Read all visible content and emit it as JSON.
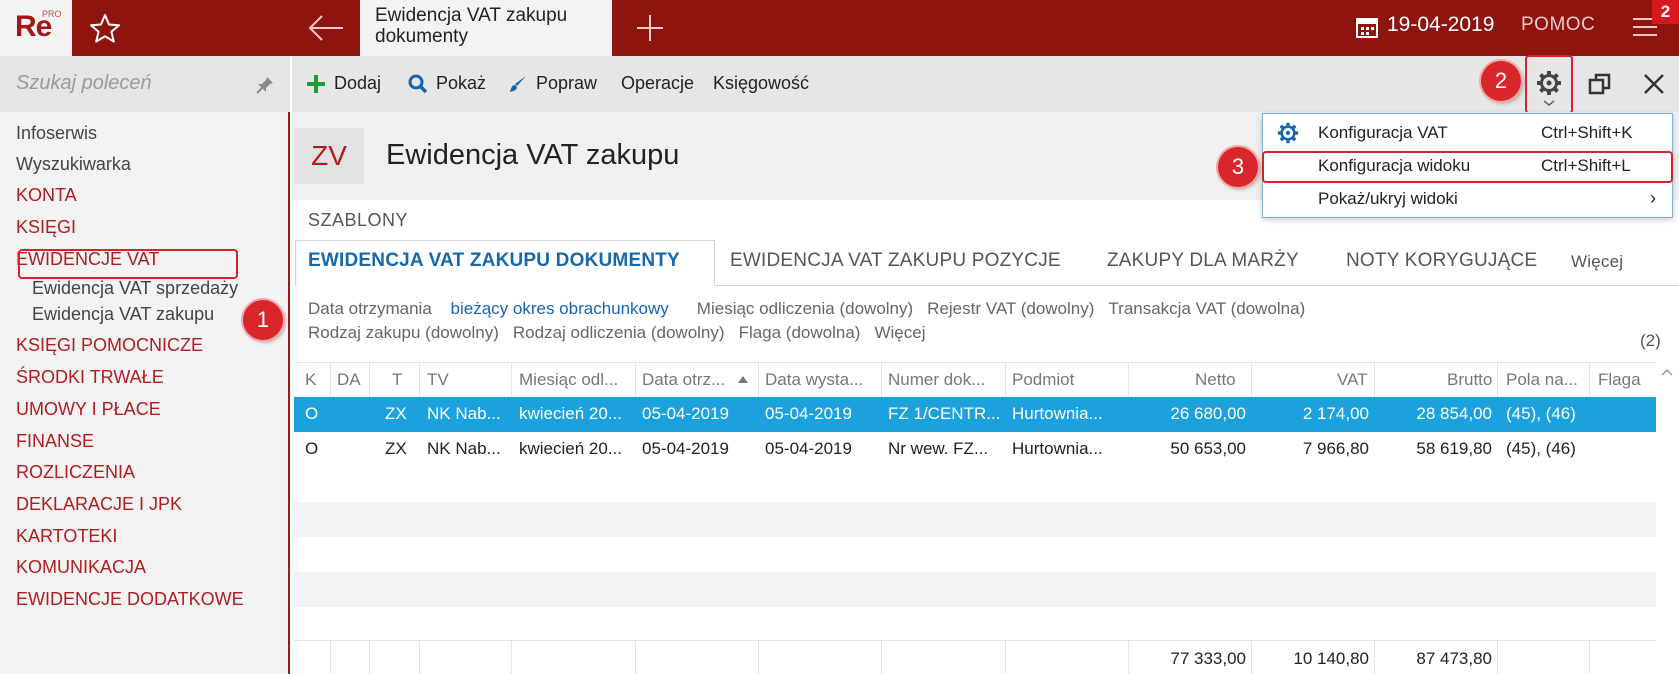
{
  "app": {
    "logo_text": "Re",
    "logo_sup": "PRO",
    "active_tab": "Ewidencja VAT zakupu dokumenty",
    "date": "19-04-2019",
    "help": "POMOC",
    "notification_count": "2"
  },
  "sidebar": {
    "search_placeholder": "Szukaj poleceń",
    "items": [
      {
        "label": "Infoserwis"
      },
      {
        "label": "Wyszukiwarka"
      },
      {
        "label": "KONTA"
      },
      {
        "label": "KSIĘGI"
      },
      {
        "label": "EWIDENCJE VAT"
      },
      {
        "label": "Ewidencja VAT sprzedaży"
      },
      {
        "label": "Ewidencja VAT zakupu"
      },
      {
        "label": "KSIĘGI POMOCNICZE"
      },
      {
        "label": "ŚRODKI TRWAŁE"
      },
      {
        "label": "UMOWY I PŁACE"
      },
      {
        "label": "FINANSE"
      },
      {
        "label": "ROZLICZENIA"
      },
      {
        "label": "DEKLARACJE I JPK"
      },
      {
        "label": "KARTOTEKI"
      },
      {
        "label": "KOMUNIKACJA"
      },
      {
        "label": "EWIDENCJE DODATKOWE"
      }
    ]
  },
  "callouts": {
    "one": "1",
    "two": "2",
    "three": "3"
  },
  "toolbar": {
    "add": "Dodaj",
    "show": "Pokaż",
    "edit": "Popraw",
    "operations": "Operacje",
    "accounting": "Księgowość"
  },
  "header": {
    "badge": "ZV",
    "title": "Ewidencja VAT zakupu"
  },
  "templates": {
    "label": "SZABLONY",
    "tabs": [
      {
        "label": "EWIDENCJA VAT ZAKUPU DOKUMENTY"
      },
      {
        "label": "EWIDENCJA VAT ZAKUPU POZYCJE"
      },
      {
        "label": "ZAKUPY DLA MARŻY"
      },
      {
        "label": "NOTY KORYGUJĄCE"
      },
      {
        "label": "Więcej"
      }
    ]
  },
  "filters": {
    "row1": [
      {
        "label": "Data otrzymania",
        "value": "bieżący okres obrachunkowy"
      },
      {
        "label": "Miesiąc odliczenia (dowolny)"
      },
      {
        "label": "Rejestr VAT (dowolny)"
      },
      {
        "label": "Transakcja VAT (dowolna)"
      }
    ],
    "row2": [
      {
        "label": "Rodzaj zakupu (dowolny)"
      },
      {
        "label": "Rodzaj odliczenia (dowolny)"
      },
      {
        "label": "Flaga (dowolna)"
      },
      {
        "label": "Więcej"
      }
    ],
    "count": "(2)"
  },
  "grid": {
    "columns": [
      "K",
      "DA",
      "T",
      "TV",
      "Miesiąc odl...",
      "Data otrz...",
      "Data wysta...",
      "Numer dok...",
      "Podmiot",
      "Netto",
      "VAT",
      "Brutto",
      "Pola na...",
      "Flaga"
    ],
    "rows": [
      [
        "O",
        "",
        "ZX",
        "NK Nab...",
        "kwiecień 20...",
        "05-04-2019",
        "05-04-2019",
        "FZ 1/CENTR...",
        "Hurtownia...",
        "26 680,00",
        "2 174,00",
        "28 854,00",
        "(45), (46)",
        ""
      ],
      [
        "O",
        "",
        "ZX",
        "NK Nab...",
        "kwiecień 20...",
        "05-04-2019",
        "05-04-2019",
        "Nr wew. FZ...",
        "Hurtownia...",
        "50 653,00",
        "7 966,80",
        "58 619,80",
        "(45), (46)",
        ""
      ]
    ],
    "totals": {
      "netto": "77 333,00",
      "vat": "10 140,80",
      "brutto": "87 473,80"
    }
  },
  "dropdown": {
    "items": [
      {
        "label": "Konfiguracja VAT",
        "shortcut": "Ctrl+Shift+K"
      },
      {
        "label": "Konfiguracja widoku",
        "shortcut": "Ctrl+Shift+L"
      },
      {
        "label": "Pokaż/ukryj widoki",
        "arrow": "›"
      }
    ]
  },
  "colors": {
    "topbar": "#8e1410",
    "accent_red": "#b01c1f",
    "selection_blue": "#1aa1de",
    "link_blue": "#1a63b3"
  }
}
